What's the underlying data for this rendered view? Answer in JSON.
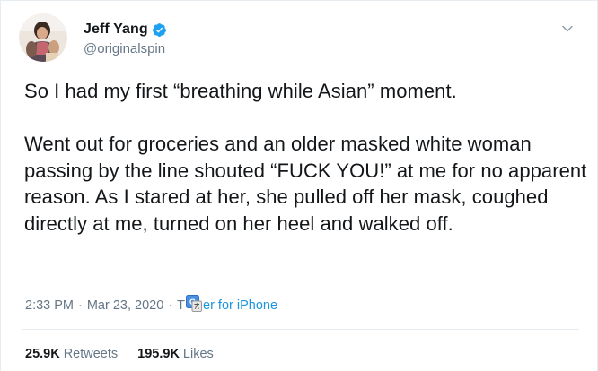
{
  "user": {
    "display_name": "Jeff Yang",
    "handle": "@originalspin",
    "verified_icon": "verified-badge-icon"
  },
  "tweet": {
    "text": "So I had my first “breathing while Asian” moment.\n\nWent out for groceries and an older masked white woman passing by the line shouted “FUCK YOU!” at me for no apparent reason. As I stared at her, she pulled off her mask, coughed directly at me, turned on her heel and walked off."
  },
  "meta": {
    "time": "2:33 PM",
    "separator": "·",
    "date": "Mar 23, 2020",
    "source_prefix": "T",
    "source_suffix": "er for iPhone"
  },
  "stats": {
    "retweets_count": "25.9K",
    "retweets_label": "Retweets",
    "likes_count": "195.9K",
    "likes_label": "Likes"
  },
  "colors": {
    "link": "#1b95e0",
    "muted": "#657786",
    "text": "#14171a",
    "verified": "#1da1f2"
  }
}
